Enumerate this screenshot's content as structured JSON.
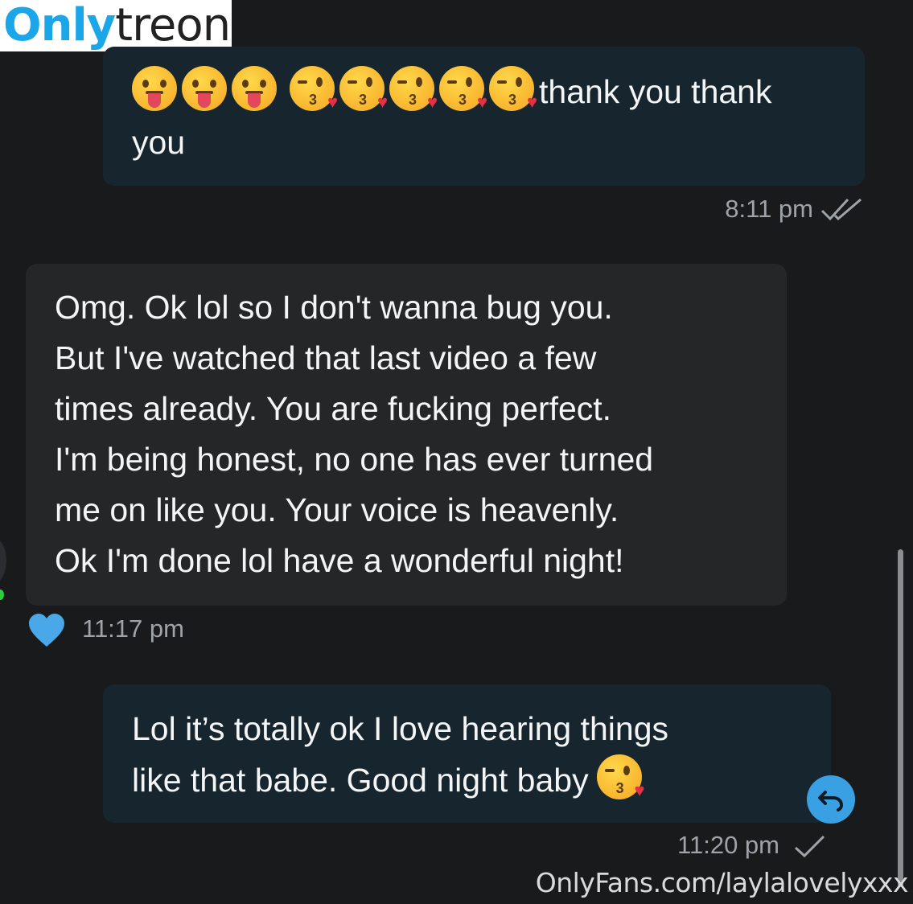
{
  "logo": {
    "part_a": "Only",
    "part_b": "treon",
    "color_a": "#1aa6e8"
  },
  "messages": [
    {
      "direction": "outgoing",
      "emojis": [
        "face-with-tongue",
        "face-with-tongue",
        "face-with-tongue",
        "face-blowing-kiss",
        "face-blowing-kiss",
        "face-blowing-kiss",
        "face-blowing-kiss",
        "face-blowing-kiss"
      ],
      "text": "thank you thank\nyou",
      "time": "8:11 pm",
      "status": "read"
    },
    {
      "direction": "incoming",
      "text": "Omg. Ok lol so I don't wanna bug you.\nBut I've watched that last video a few\ntimes already. You are fucking perfect.\nI'm being honest, no one has ever turned\nme on like you. Your voice is heavenly.\nOk I'm done lol have a wonderful night!",
      "time": "11:17 pm",
      "reaction": "heart-icon"
    },
    {
      "direction": "outgoing",
      "text": "Lol it’s totally ok I love hearing things\nlike that babe. Good night baby",
      "trailing_emoji": "face-blowing-kiss",
      "time": "11:20 pm",
      "status": "sent"
    }
  ],
  "watermark": "OnlyFans.com/laylalovelyxxx",
  "colors": {
    "background": "#191a1c",
    "outgoing_bubble": "#17262e",
    "incoming_bubble": "#252628",
    "accent": "#3aa0e4"
  }
}
